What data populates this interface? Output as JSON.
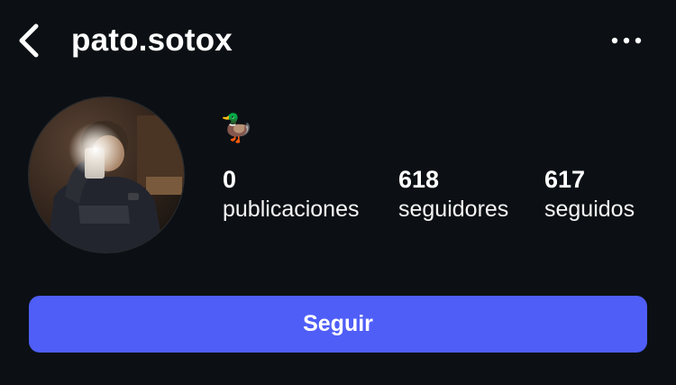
{
  "header": {
    "username": "pato.sotox",
    "back_icon": "chevron-left-icon",
    "more_icon": "more-horizontal-icon"
  },
  "profile": {
    "bio_emoji": "🦆",
    "avatar": "profile-photo"
  },
  "stats": {
    "posts": {
      "count": "0",
      "label": "publicaciones"
    },
    "followers": {
      "count": "618",
      "label": "seguidores"
    },
    "following": {
      "count": "617",
      "label": "seguidos"
    }
  },
  "actions": {
    "follow_label": "Seguir"
  },
  "colors": {
    "background": "#0c1014",
    "primary_button": "#4f5ef7",
    "text": "#ffffff"
  }
}
